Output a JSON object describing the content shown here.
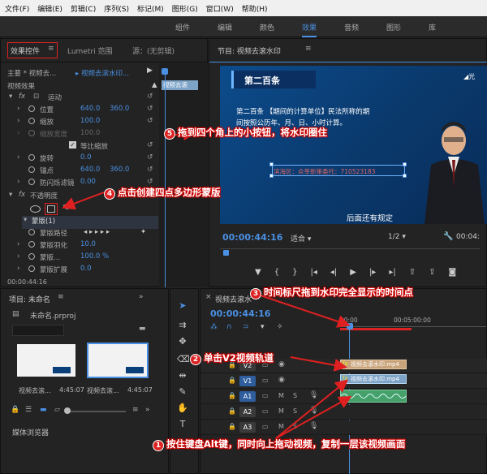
{
  "menu": [
    "文件(F)",
    "编辑(E)",
    "剪辑(C)",
    "序列(S)",
    "标记(M)",
    "图形(G)",
    "窗口(W)",
    "帮助(H)"
  ],
  "workspace_tabs": [
    "组件",
    "编辑",
    "颜色",
    "效果",
    "音频",
    "图形",
    "库"
  ],
  "effect_panel": {
    "tab_effect_controls": "效果控件",
    "tab_lumetri": "Lumetri 范围",
    "tab_source": "源：(无剪辑)",
    "master": "主要 * 视频去...",
    "clip": "视频去滚水印...",
    "timeline_clip": "视频去滚",
    "video_effects": "视频效果",
    "motion": "运动",
    "position": "位置",
    "position_x": "640.0",
    "position_y": "360.0",
    "scale": "缩放",
    "scale_val": "100.0",
    "scale_width": "缩放宽度",
    "scale_width_val": "100.0",
    "uniform_scale": "等比缩放",
    "rotation": "旋转",
    "rotation_val": "0.0",
    "anchor": "锚点",
    "anchor_x": "640.0",
    "anchor_y": "360.0",
    "anti_flicker": "防闪烁滤镜",
    "anti_flicker_val": "0.00",
    "opacity": "不透明度",
    "mask": "蒙版(1)",
    "mask_path": "蒙版路径",
    "mask_feather": "蒙版羽化",
    "mask_feather_val": "10.0",
    "mask_opacity": "蒙版...",
    "mask_opacity_val": "100.0 %",
    "mask_expand": "蒙版扩展",
    "mask_expand_val": "0.0",
    "timecode": "00:00:44:16"
  },
  "program": {
    "title": "节目: 视频去滚水印",
    "slide_header": "第二百条",
    "slide_text_1": "第二百条 【期间的计算单位】民法所称的期",
    "slide_text_2": "间按照公历年、月、日、小时计算。",
    "watermark": "滨海区：众莘新策委托：710523183",
    "subtitle": "后面还有规定",
    "timecode": "00:00:44:16",
    "fit": "适合",
    "quality": "1/2",
    "duration": "00:04:"
  },
  "project": {
    "title": "项目: 未命名",
    "file": "未命名.prproj",
    "thumb1_label": "视频去滚...",
    "thumb1_dur": "4:45:07",
    "thumb2_label": "视频去滚...",
    "thumb2_dur": "4:45:07",
    "media_browser": "媒体浏览器"
  },
  "timeline": {
    "title": "视频去滚水",
    "timecode": "00:00:44:16",
    "ruler_1": "00:00",
    "ruler_2": "00:05:00:00",
    "tracks": [
      "V2",
      "V1",
      "A1",
      "A2",
      "A3"
    ],
    "clip_v2": "视频去滚水印.mp4",
    "clip_v1": "视频去滚水印.mp4"
  },
  "callouts": {
    "c1": "按住键盘Alt键，同时向上拖动视频，复制一层该视频画面",
    "c2": "单击V2视频轨道",
    "c3": "时间标尺拖到水印完全显示的时间点",
    "c4": "点击创建四点多边形蒙版",
    "c5": "拖到四个角上的小按钮，将水印圈住"
  },
  "colors": {
    "accent": "#4a90e2",
    "callout_red": "#d22222",
    "slide_bg": "#0b3f7a"
  }
}
